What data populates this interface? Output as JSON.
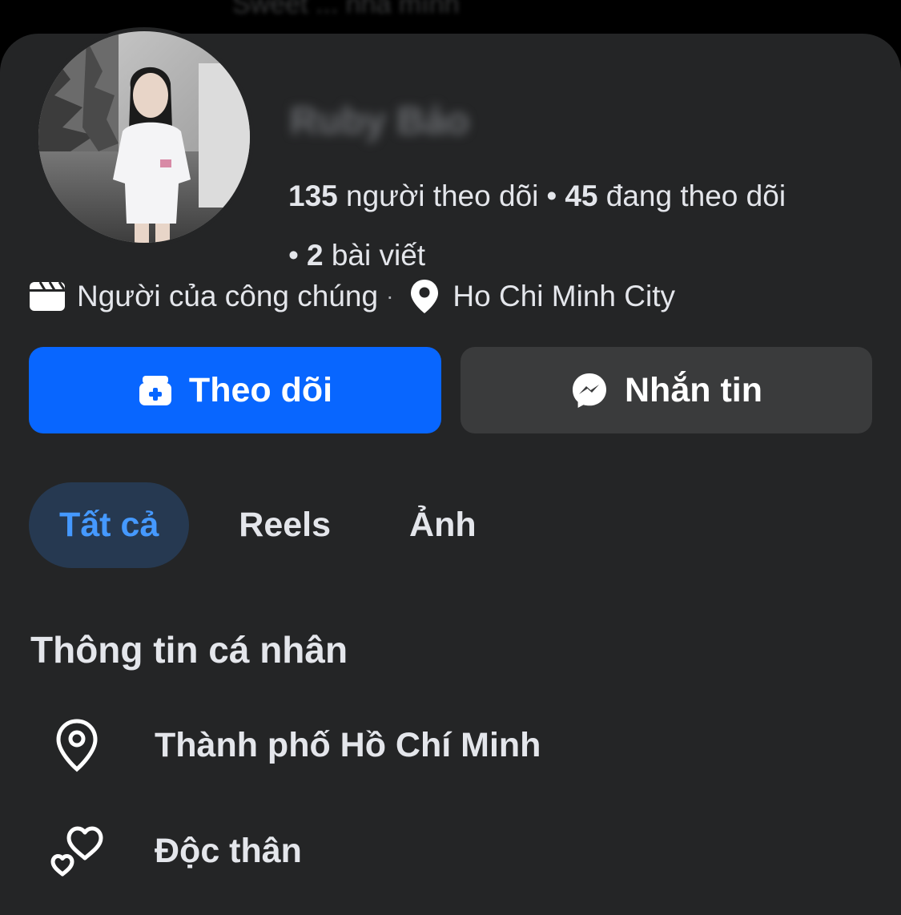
{
  "top_bar": {
    "ghost_text": "Sweet ... nhà mình"
  },
  "profile": {
    "name": "Ruby Bảo",
    "stats": {
      "followers_count": "135",
      "followers_label": "người theo dõi",
      "following_count": "45",
      "following_label": "đang theo dõi",
      "posts_count": "2",
      "posts_label": "bài viết",
      "separator": "•"
    },
    "category": "Người của công chúng",
    "location": "Ho Chi Minh City",
    "meta_separator": "·"
  },
  "actions": {
    "follow_label": "Theo dõi",
    "message_label": "Nhắn tin"
  },
  "tabs": [
    {
      "label": "Tất cả",
      "active": true
    },
    {
      "label": "Reels",
      "active": false
    },
    {
      "label": "Ảnh",
      "active": false
    }
  ],
  "about": {
    "title": "Thông tin cá nhân",
    "items": [
      {
        "icon": "location-pin-icon",
        "text": "Thành phố Hồ Chí Minh"
      },
      {
        "icon": "hearts-icon",
        "text": "Độc thân"
      }
    ]
  },
  "colors": {
    "background": "#242526",
    "primary_button": "#0866ff",
    "secondary_button": "#3a3b3c",
    "active_tab_bg": "#263951",
    "active_tab_text": "#4599ff",
    "text": "#e4e6eb"
  }
}
